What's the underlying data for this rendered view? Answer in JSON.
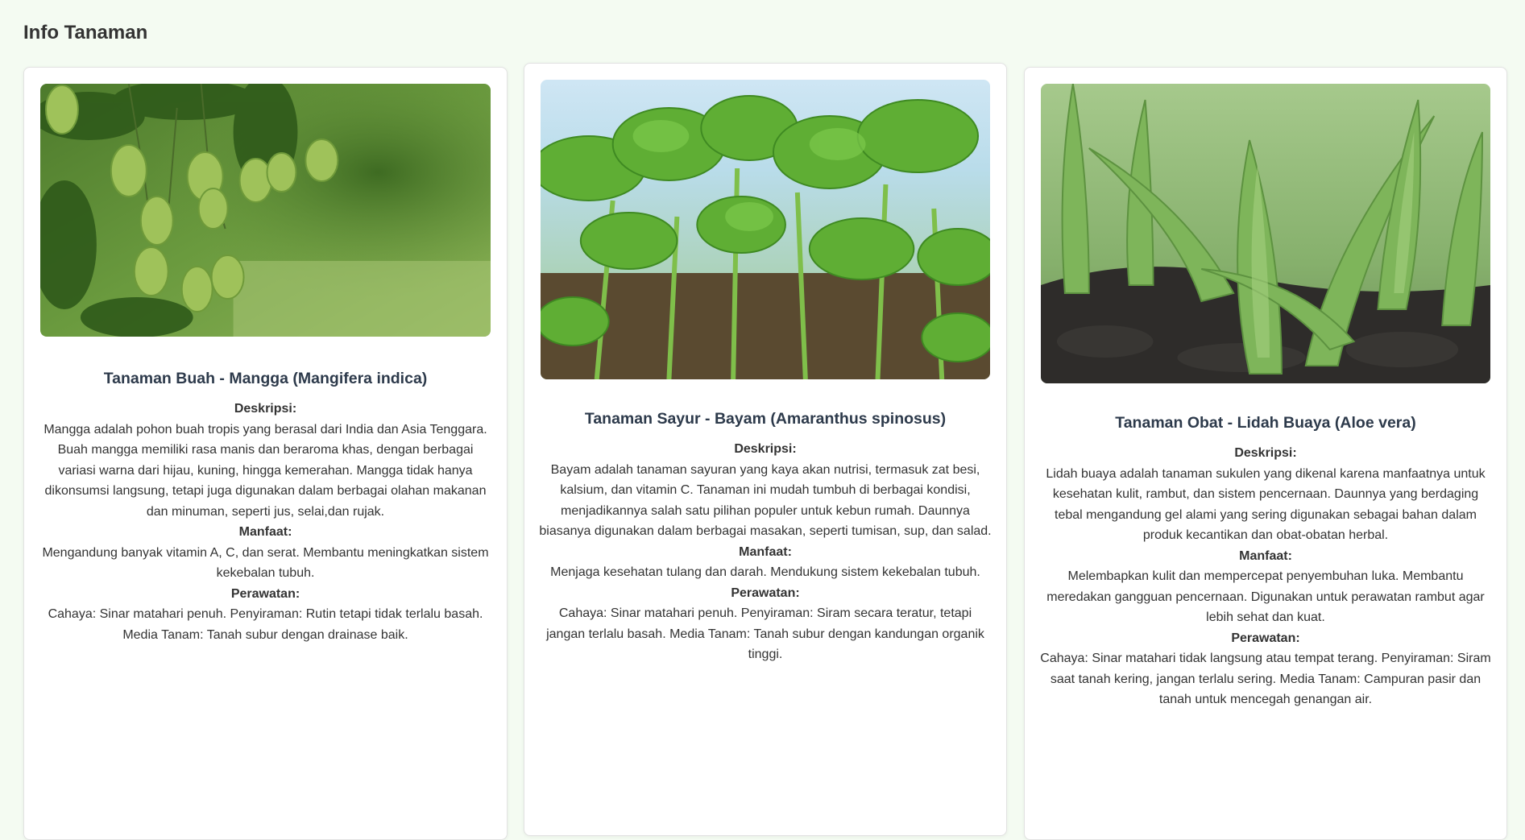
{
  "page": {
    "title": "Info Tanaman"
  },
  "cards": [
    {
      "image_alt": "mango-tree-image",
      "title": "Tanaman Buah - Mangga (Mangifera indica)",
      "deskripsi_label": "Deskripsi:",
      "deskripsi": "Mangga adalah pohon buah tropis yang berasal dari India dan Asia Tenggara. Buah mangga memiliki rasa manis dan beraroma khas, dengan berbagai variasi warna dari hijau, kuning, hingga kemerahan. Mangga tidak hanya dikonsumsi langsung, tetapi juga digunakan dalam berbagai olahan makanan dan minuman, seperti jus, selai,dan rujak.",
      "manfaat_label": "Manfaat:",
      "manfaat": "Mengandung banyak vitamin A, C, dan serat. Membantu meningkatkan sistem kekebalan tubuh.",
      "perawatan_label": "Perawatan:",
      "perawatan": "Cahaya: Sinar matahari penuh. Penyiraman: Rutin tetapi tidak terlalu basah. Media Tanam: Tanah subur dengan drainase baik."
    },
    {
      "image_alt": "spinach-field-image",
      "title": "Tanaman Sayur - Bayam (Amaranthus spinosus)",
      "deskripsi_label": "Deskripsi:",
      "deskripsi": "Bayam adalah tanaman sayuran yang kaya akan nutrisi, termasuk zat besi, kalsium, dan vitamin C. Tanaman ini mudah tumbuh di berbagai kondisi, menjadikannya salah satu pilihan populer untuk kebun rumah. Daunnya biasanya digunakan dalam berbagai masakan, seperti tumisan, sup, dan salad.",
      "manfaat_label": "Manfaat:",
      "manfaat": "Menjaga kesehatan tulang dan darah. Mendukung sistem kekebalan tubuh.",
      "perawatan_label": "Perawatan:",
      "perawatan": "Cahaya: Sinar matahari penuh. Penyiraman: Siram secara teratur, tetapi jangan terlalu basah. Media Tanam: Tanah subur dengan kandungan organik tinggi."
    },
    {
      "image_alt": "aloe-vera-image",
      "title": "Tanaman Obat - Lidah Buaya (Aloe vera)",
      "deskripsi_label": "Deskripsi:",
      "deskripsi": "Lidah buaya adalah tanaman sukulen yang dikenal karena manfaatnya untuk kesehatan kulit, rambut, dan sistem pencernaan. Daunnya yang berdaging tebal mengandung gel alami yang sering digunakan sebagai bahan dalam produk kecantikan dan obat-obatan herbal.",
      "manfaat_label": "Manfaat:",
      "manfaat": "Melembapkan kulit dan mempercepat penyembuhan luka. Membantu meredakan gangguan pencernaan. Digunakan untuk perawatan rambut agar lebih sehat dan kuat.",
      "perawatan_label": "Perawatan:",
      "perawatan": "Cahaya: Sinar matahari tidak langsung atau tempat terang. Penyiraman: Siram saat tanah kering, jangan terlalu sering. Media Tanam: Campuran pasir dan tanah untuk mencegah genangan air."
    }
  ]
}
